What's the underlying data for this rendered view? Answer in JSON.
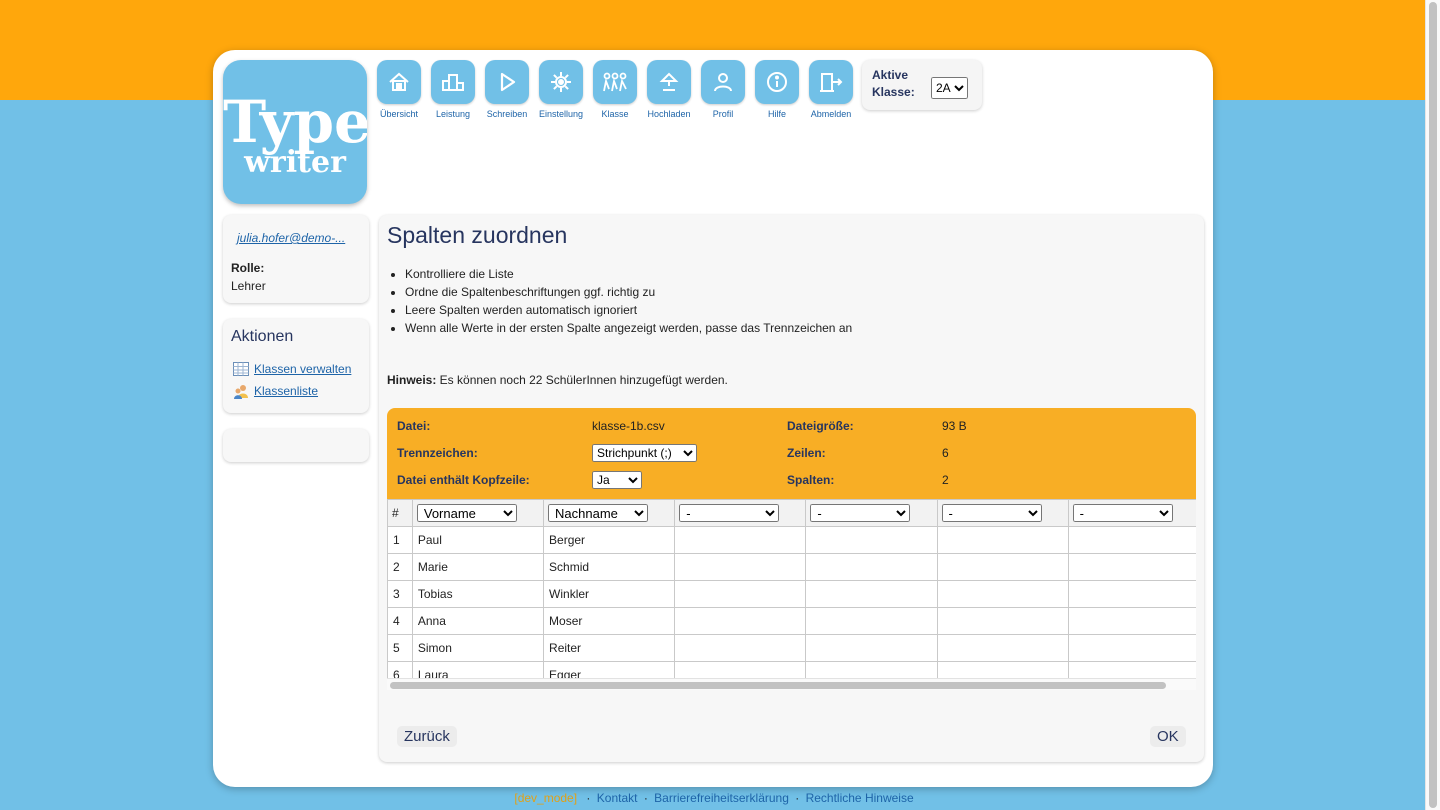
{
  "logo": {
    "line1": "Type",
    "line2": "writer"
  },
  "nav": [
    {
      "label": "Übersicht",
      "icon": "house-icon"
    },
    {
      "label": "Leistung",
      "icon": "podium-icon"
    },
    {
      "label": "Schreiben",
      "icon": "play-icon"
    },
    {
      "label": "Einstellung",
      "icon": "gear-icon"
    },
    {
      "label": "Klasse",
      "icon": "group-icon"
    },
    {
      "label": "Hochladen",
      "icon": "upload-icon"
    },
    {
      "label": "Profil",
      "icon": "person-icon"
    },
    {
      "label": "Hilfe",
      "icon": "info-icon"
    },
    {
      "label": "Abmelden",
      "icon": "exit-door-icon"
    }
  ],
  "active_class": {
    "label": "Aktive Klasse:",
    "value": "2A"
  },
  "user": {
    "email": "julia.hofer@demo-...",
    "role_label": "Rolle:",
    "role": "Lehrer"
  },
  "actions": {
    "title": "Aktionen",
    "items": [
      {
        "label": "Klassen verwalten",
        "icon": "table-icon"
      },
      {
        "label": "Klassenliste",
        "icon": "users-icon"
      }
    ]
  },
  "main": {
    "title": "Spalten zuordnen",
    "instructions": [
      "Kontrolliere die Liste",
      "Ordne die Spaltenbeschriftungen ggf. richtig zu",
      "Leere Spalten werden automatisch ignoriert",
      "Wenn alle Werte in der ersten Spalte angezeigt werden, passe das Trennzeichen an"
    ],
    "hint_label": "Hinweis:",
    "hint_text": " Es können noch 22 SchülerInnen hinzugefügt werden."
  },
  "file": {
    "file_label": "Datei:",
    "file_value": "klasse-1b.csv",
    "size_label": "Dateigröße:",
    "size_value": "93 B",
    "sep_label": "Trennzeichen:",
    "sep_value": "Strichpunkt (;)",
    "rows_label": "Zeilen:",
    "rows_value": "6",
    "header_label": "Datei enthält Kopfzeile:",
    "header_value": "Ja",
    "cols_label": "Spalten:",
    "cols_value": "2"
  },
  "table": {
    "hash": "#",
    "columns": [
      "Vorname",
      "Nachname",
      "-",
      "-",
      "-",
      "-",
      "-"
    ],
    "rows": [
      [
        "1",
        "Paul",
        "Berger"
      ],
      [
        "2",
        "Marie",
        "Schmid"
      ],
      [
        "3",
        "Tobias",
        "Winkler"
      ],
      [
        "4",
        "Anna",
        "Moser"
      ],
      [
        "5",
        "Simon",
        "Reiter"
      ],
      [
        "6",
        "Laura",
        "Egger"
      ]
    ]
  },
  "buttons": {
    "back": "Zurück",
    "ok": "OK"
  },
  "footer": {
    "tag": "[dev_mode]",
    "links": [
      "Kontakt",
      "Barrierefreiheitserklärung",
      "Rechtliche Hinweise"
    ]
  },
  "colors": {
    "orange": "#ffa70c",
    "blue": "#71c0e7",
    "panel_orange": "#f8ae25",
    "navy": "#27355f",
    "link": "#1e64a8"
  }
}
